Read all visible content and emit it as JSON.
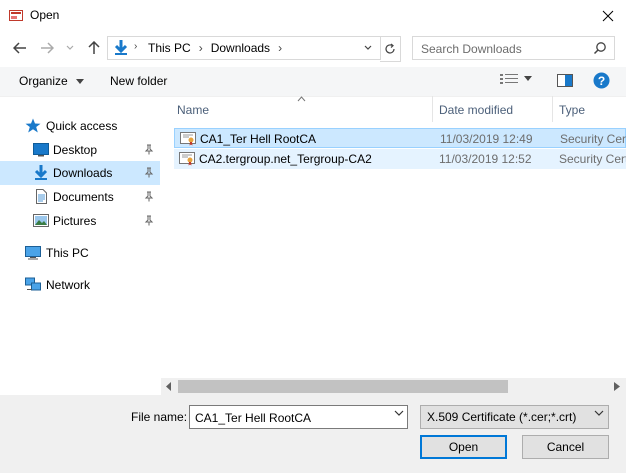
{
  "window": {
    "title": "Open"
  },
  "address": {
    "crumbs": [
      "This PC",
      "Downloads"
    ]
  },
  "search": {
    "placeholder": "Search Downloads"
  },
  "toolbar": {
    "organize": "Organize",
    "new_folder": "New folder"
  },
  "nav": {
    "quick_access": "Quick access",
    "items": [
      {
        "label": "Desktop"
      },
      {
        "label": "Downloads"
      },
      {
        "label": "Documents"
      },
      {
        "label": "Pictures"
      }
    ],
    "this_pc": "This PC",
    "network": "Network"
  },
  "columns": {
    "name": "Name",
    "date": "Date modified",
    "type": "Type"
  },
  "files": [
    {
      "name": "CA1_Ter Hell RootCA",
      "date": "11/03/2019 12:49",
      "type": "Security Certificate"
    },
    {
      "name": "CA2.tergroup.net_Tergroup-CA2",
      "date": "11/03/2019 12:52",
      "type": "Security Certificate"
    }
  ],
  "bottom": {
    "file_name_label": "File name:",
    "file_name_value": "CA1_Ter Hell RootCA",
    "filter": "X.509 Certificate (*.cer;*.crt)",
    "open": "Open",
    "cancel": "Cancel"
  },
  "colors": {
    "accent": "#0078d7",
    "selected": "#cce8ff",
    "hover": "#e5f3ff",
    "help": "#1979ca"
  }
}
